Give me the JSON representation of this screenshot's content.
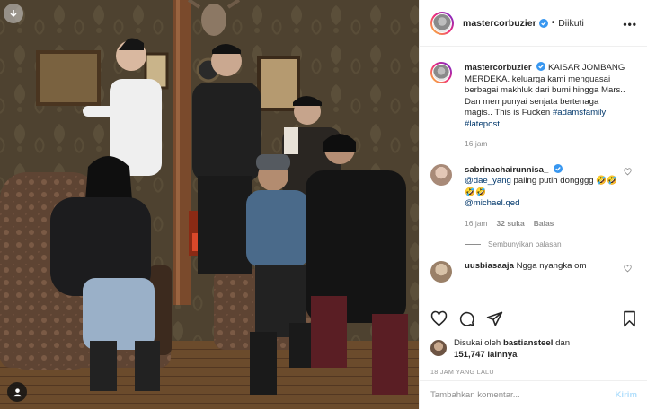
{
  "header": {
    "username": "mastercorbuzier",
    "separator": "•",
    "follow_status": "Diikuti",
    "more_icon": "more-horizontal-icon"
  },
  "caption": {
    "username": "mastercorbuzier",
    "text_part1": "KAISAR JOMBANG MERDEKA. keluarga kami menguasai berbagai makhluk dari bumi hingga Mars.. Dan mempunyai senjata bertenaga magis.. This is Fucken ",
    "hashtag1": "#adamsfamily",
    "hashtag2": "#latepost",
    "time": "16 jam"
  },
  "comments": [
    {
      "username": "sabrinachairunnisa_",
      "mention1": "@dae_yang",
      "text_mid": " paling putih dongggg ",
      "emoji": "🤣🤣🤣🤣",
      "mention2": "@michael.qed",
      "time": "16 jam",
      "likes": "32 suka",
      "reply": "Balas"
    },
    {
      "username": "uusbiasaaja",
      "text": "Ngga nyangka om"
    }
  ],
  "hide_replies": "Sembunyikan balasan",
  "likes": {
    "prefix": "Disukai oleh",
    "user": "bastiansteel",
    "and": "dan",
    "count": "151,747 lainnya"
  },
  "time_ago": "18 JAM YANG LALU",
  "add_comment": {
    "placeholder": "Tambahkan komentar...",
    "post_label": "Kirim"
  },
  "colors": {
    "link": "#00376b",
    "verified": "#3897f0",
    "muted": "#8e8e8e",
    "post_disabled": "#b2dffc"
  }
}
